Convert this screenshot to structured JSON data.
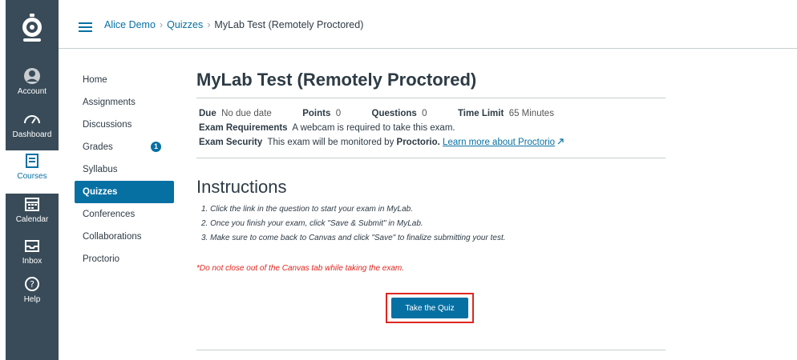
{
  "global_nav": {
    "items": [
      {
        "label": "Account",
        "icon": "account-icon"
      },
      {
        "label": "Dashboard",
        "icon": "dashboard-icon"
      },
      {
        "label": "Courses",
        "icon": "courses-icon"
      },
      {
        "label": "Calendar",
        "icon": "calendar-icon"
      },
      {
        "label": "Inbox",
        "icon": "inbox-icon"
      },
      {
        "label": "Help",
        "icon": "help-icon"
      }
    ]
  },
  "breadcrumb": {
    "course": "Alice Demo",
    "section": "Quizzes",
    "current": "MyLab Test (Remotely Proctored)",
    "separator": "›"
  },
  "course_nav": {
    "items": [
      {
        "label": "Home"
      },
      {
        "label": "Assignments"
      },
      {
        "label": "Discussions"
      },
      {
        "label": "Grades",
        "badge": "1"
      },
      {
        "label": "Syllabus"
      },
      {
        "label": "Quizzes",
        "active": true
      },
      {
        "label": "Conferences"
      },
      {
        "label": "Collaborations"
      },
      {
        "label": "Proctorio"
      }
    ]
  },
  "quiz": {
    "title": "MyLab Test (Remotely Proctored)",
    "due_label": "Due",
    "due_value": "No due date",
    "points_label": "Points",
    "points_value": "0",
    "questions_label": "Questions",
    "questions_value": "0",
    "time_limit_label": "Time Limit",
    "time_limit_value": "65 Minutes",
    "exam_req_label": "Exam Requirements",
    "exam_req_value": "A webcam is required to take this exam.",
    "exam_sec_label": "Exam Security",
    "exam_sec_value": "This exam will be monitored by",
    "exam_sec_brand": "Proctorio.",
    "exam_sec_link": "Learn more about Proctorio"
  },
  "instructions": {
    "heading": "Instructions",
    "steps": [
      "1. Click the link in the question to start your exam in MyLab.",
      "2. Once you finish your exam, click \"Save & Submit\" in MyLab.",
      "3. Make sure to come back to Canvas and click \"Save\" to finalize submitting your test."
    ],
    "warning": "*Do not close out of the Canvas tab while taking the exam.",
    "button_label": "Take the Quiz"
  },
  "colors": {
    "nav_bg": "#394b58",
    "accent": "#0770a3",
    "highlight_red": "#e0261e"
  }
}
